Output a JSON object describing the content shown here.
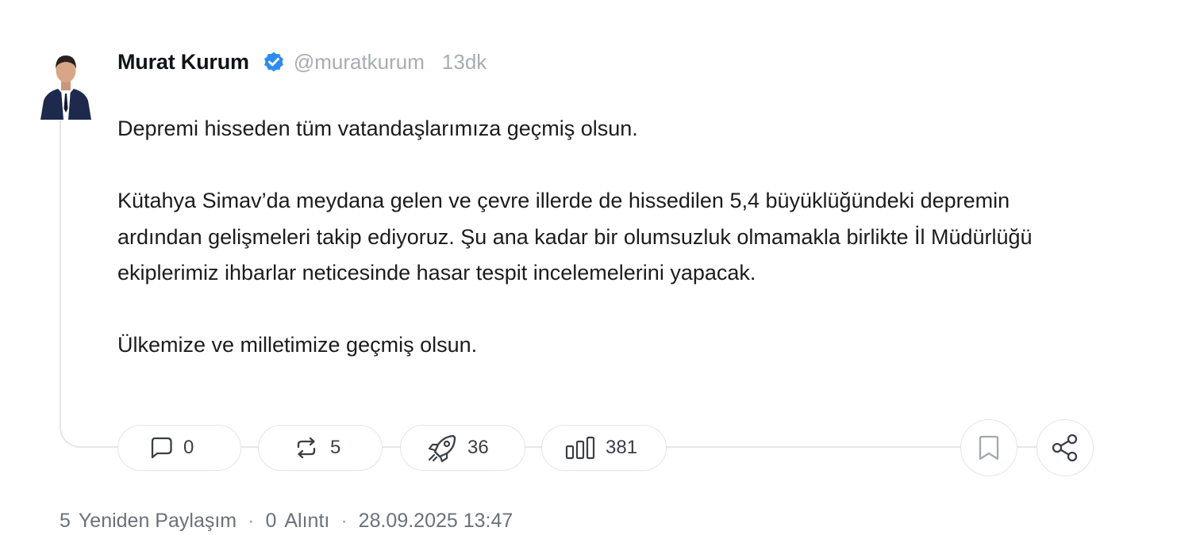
{
  "author": {
    "name": "Murat Kurum",
    "handle": "@muratkurum",
    "time_ago": "13dk",
    "verified_color": "#2d8cf0"
  },
  "post": {
    "paragraphs": [
      "Depremi hisseden tüm vatandaşlarımıza geçmiş olsun.",
      "Kütahya Simav’da meydana gelen ve çevre illerde de hissedilen 5,4 büyüklüğündeki depremin ardından gelişmeleri takip ediyoruz. Şu ana kadar bir olumsuzluk olmamakla birlikte İl Müdürlüğü ekiplerimiz ihbarlar neticesinde hasar tespit incelemelerini yapacak.",
      "Ülkemize ve milletimize geçmiş olsun."
    ]
  },
  "actions": {
    "reply": {
      "icon": "speech-bubble-icon",
      "count": "0"
    },
    "repost": {
      "icon": "repost-icon",
      "count": "5"
    },
    "boost": {
      "icon": "rocket-icon",
      "count": "36"
    },
    "views": {
      "icon": "bar-chart-icon",
      "count": "381"
    },
    "bookmark": {
      "icon": "bookmark-icon"
    },
    "share": {
      "icon": "share-icon"
    }
  },
  "footer": {
    "reposts_count": "5",
    "reposts_label": "Yeniden Paylaşım",
    "quotes_count": "0",
    "quotes_label": "Alıntı",
    "separator": "·",
    "timestamp": "28.09.2025 13:47"
  }
}
